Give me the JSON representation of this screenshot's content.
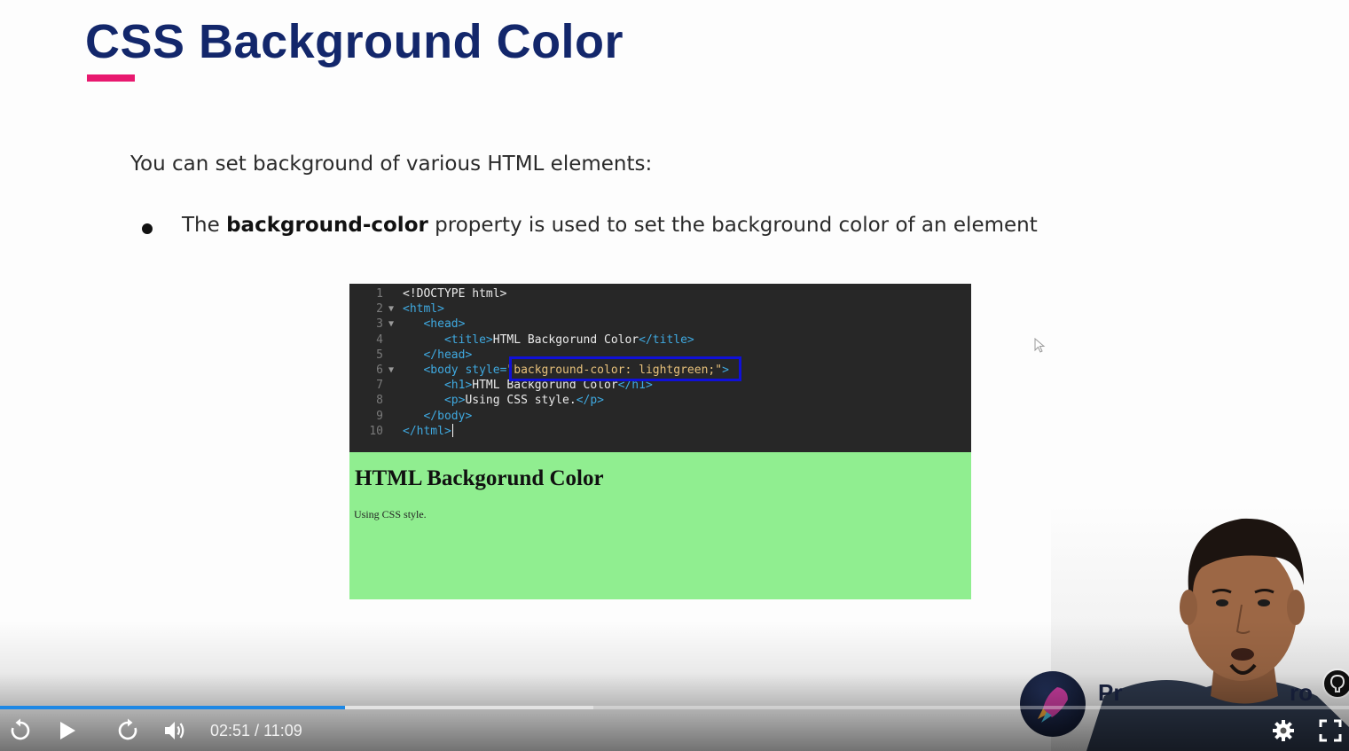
{
  "slide": {
    "title": "CSS Background Color",
    "intro": "You can set background of various HTML elements:",
    "bullet": {
      "prefix": "The",
      "bold": "background-color",
      "suffix": "property is used to set the background color of an element"
    }
  },
  "code_editor": {
    "lines": [
      {
        "num": "1",
        "fold": "",
        "parts": [
          {
            "t": "<!DOCTYPE html>",
            "c": "txt"
          }
        ]
      },
      {
        "num": "2",
        "fold": "▼",
        "parts": [
          {
            "t": "<html>",
            "c": "tag"
          }
        ]
      },
      {
        "num": "3",
        "fold": "▼",
        "parts": [
          {
            "t": "   ",
            "c": "txt"
          },
          {
            "t": "<head>",
            "c": "tag"
          }
        ]
      },
      {
        "num": "4",
        "fold": "",
        "parts": [
          {
            "t": "      ",
            "c": "txt"
          },
          {
            "t": "<title>",
            "c": "tag"
          },
          {
            "t": "HTML Backgorund Color",
            "c": "txt"
          },
          {
            "t": "</title>",
            "c": "tag"
          }
        ]
      },
      {
        "num": "5",
        "fold": "",
        "parts": [
          {
            "t": "   ",
            "c": "txt"
          },
          {
            "t": "</head>",
            "c": "tag"
          }
        ]
      },
      {
        "num": "6",
        "fold": "▼",
        "parts": [
          {
            "t": "   ",
            "c": "txt"
          },
          {
            "t": "<body ",
            "c": "tag"
          },
          {
            "t": "style=",
            "c": "attr"
          },
          {
            "t": "\"background-color: lightgreen;\"",
            "c": "str"
          },
          {
            "t": ">",
            "c": "tag"
          }
        ]
      },
      {
        "num": "7",
        "fold": "",
        "parts": [
          {
            "t": "      ",
            "c": "txt"
          },
          {
            "t": "<h1>",
            "c": "tag"
          },
          {
            "t": "HTML Backgorund Color",
            "c": "txt"
          },
          {
            "t": "</h1>",
            "c": "tag"
          }
        ]
      },
      {
        "num": "8",
        "fold": "",
        "parts": [
          {
            "t": "      ",
            "c": "txt"
          },
          {
            "t": "<p>",
            "c": "tag"
          },
          {
            "t": "Using CSS style.",
            "c": "txt"
          },
          {
            "t": "</p>",
            "c": "tag"
          }
        ]
      },
      {
        "num": "9",
        "fold": "",
        "parts": [
          {
            "t": "   ",
            "c": "txt"
          },
          {
            "t": "</body>",
            "c": "tag"
          }
        ]
      },
      {
        "num": "10",
        "fold": "",
        "parts": [
          {
            "t": "</html>",
            "c": "tag"
          }
        ]
      }
    ]
  },
  "rendered_output": {
    "heading": "HTML Backgorund Color",
    "paragraph": "Using CSS style.",
    "background_color": "#90ee90"
  },
  "webcam": {
    "brand_text_left": "Pr",
    "brand_text_right": "ro"
  },
  "player": {
    "current_time": "02:51",
    "separator": " / ",
    "duration": "11:09",
    "played_fraction": 0.2557,
    "buffered_fraction": 0.44,
    "accent_color": "#1e88e5",
    "icons": [
      "replay-icon",
      "play-icon",
      "forward-icon",
      "volume-icon",
      "settings-icon",
      "fullscreen-icon"
    ]
  }
}
